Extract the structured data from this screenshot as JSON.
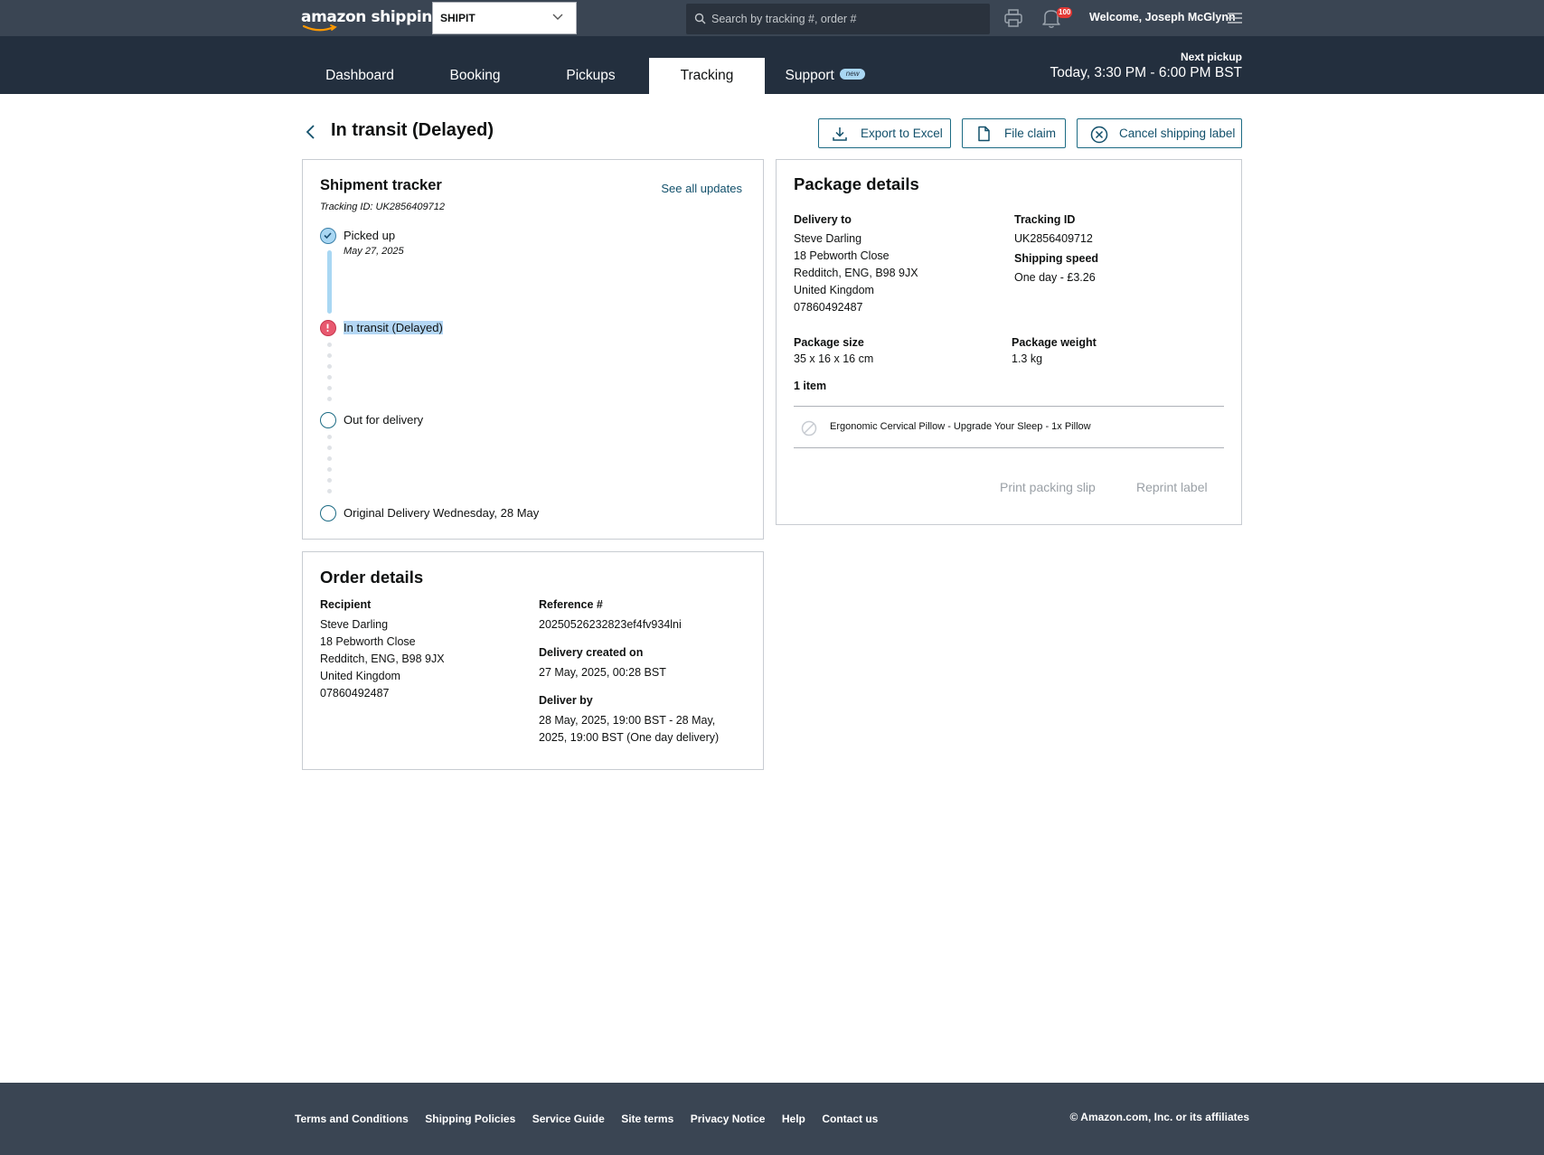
{
  "header": {
    "logo_text": "amazon shipping",
    "account_selector": "SHIPIT",
    "search_placeholder": "Search by tracking #, order #",
    "notifications_count": "100",
    "welcome": "Welcome, Joseph McGlynn"
  },
  "nav": {
    "tabs": [
      {
        "label": "Dashboard"
      },
      {
        "label": "Booking"
      },
      {
        "label": "Pickups"
      },
      {
        "label": "Tracking",
        "active": true
      },
      {
        "label": "Support",
        "badge": "new"
      }
    ],
    "next_pickup_label": "Next pickup",
    "next_pickup_value": "Today, 3:30 PM - 6:00 PM BST"
  },
  "page": {
    "title": "In transit (Delayed)",
    "actions": {
      "export": "Export to Excel",
      "file_claim": "File claim",
      "cancel_label": "Cancel shipping label"
    }
  },
  "tracker": {
    "title": "Shipment tracker",
    "see_all": "See all updates",
    "tracking_id_line": "Tracking ID: UK2856409712",
    "steps": [
      {
        "label": "Picked up",
        "date": "May 27, 2025",
        "status": "done"
      },
      {
        "label": "In transit (Delayed)",
        "status": "alert"
      },
      {
        "label": "Out for delivery",
        "status": "pending"
      },
      {
        "label": "Original Delivery Wednesday, 28 May",
        "status": "pending"
      }
    ]
  },
  "order": {
    "title": "Order details",
    "recipient_label": "Recipient",
    "recipient": {
      "name": "Steve Darling",
      "street": "18 Pebworth Close",
      "city": "Redditch, ENG, B98 9JX",
      "country": "United Kingdom",
      "phone": "07860492487"
    },
    "reference_label": "Reference #",
    "reference": "20250526232823ef4fv934lni",
    "created_label": "Delivery created on",
    "created": "27 May, 2025, 00:28 BST",
    "deliver_by_label": "Deliver by",
    "deliver_by_line1": "28 May, 2025, 19:00 BST - 28 May,",
    "deliver_by_line2": "2025, 19:00 BST (One day delivery)"
  },
  "package": {
    "title": "Package details",
    "delivery_to_label": "Delivery to",
    "delivery_to": {
      "name": "Steve Darling",
      "street": "18 Pebworth Close",
      "city": "Redditch, ENG, B98 9JX",
      "country": "United Kingdom",
      "phone": "07860492487"
    },
    "tracking_id_label": "Tracking ID",
    "tracking_id": "UK2856409712",
    "speed_label": "Shipping speed",
    "speed": "One day - £3.26",
    "size_label": "Package size",
    "size": "35 x 16 x 16 cm",
    "weight_label": "Package weight",
    "weight": "1.3 kg",
    "items_count": "1 item",
    "items": [
      {
        "name": "Ergonomic Cervical Pillow - Upgrade Your Sleep - 1x Pillow"
      }
    ],
    "print_slip": "Print packing slip",
    "reprint_label": "Reprint label"
  },
  "footer": {
    "links": [
      "Terms and Conditions",
      "Shipping Policies",
      "Service Guide",
      "Site terms",
      "Privacy Notice",
      "Help",
      "Contact us"
    ],
    "copyright": "© Amazon.com, Inc. or its affiliates"
  },
  "colors": {
    "topbar": "#3a4553",
    "navbar": "#232f3e",
    "accent": "#12506b",
    "alert": "#e8596f",
    "done": "#a9d7f3"
  }
}
